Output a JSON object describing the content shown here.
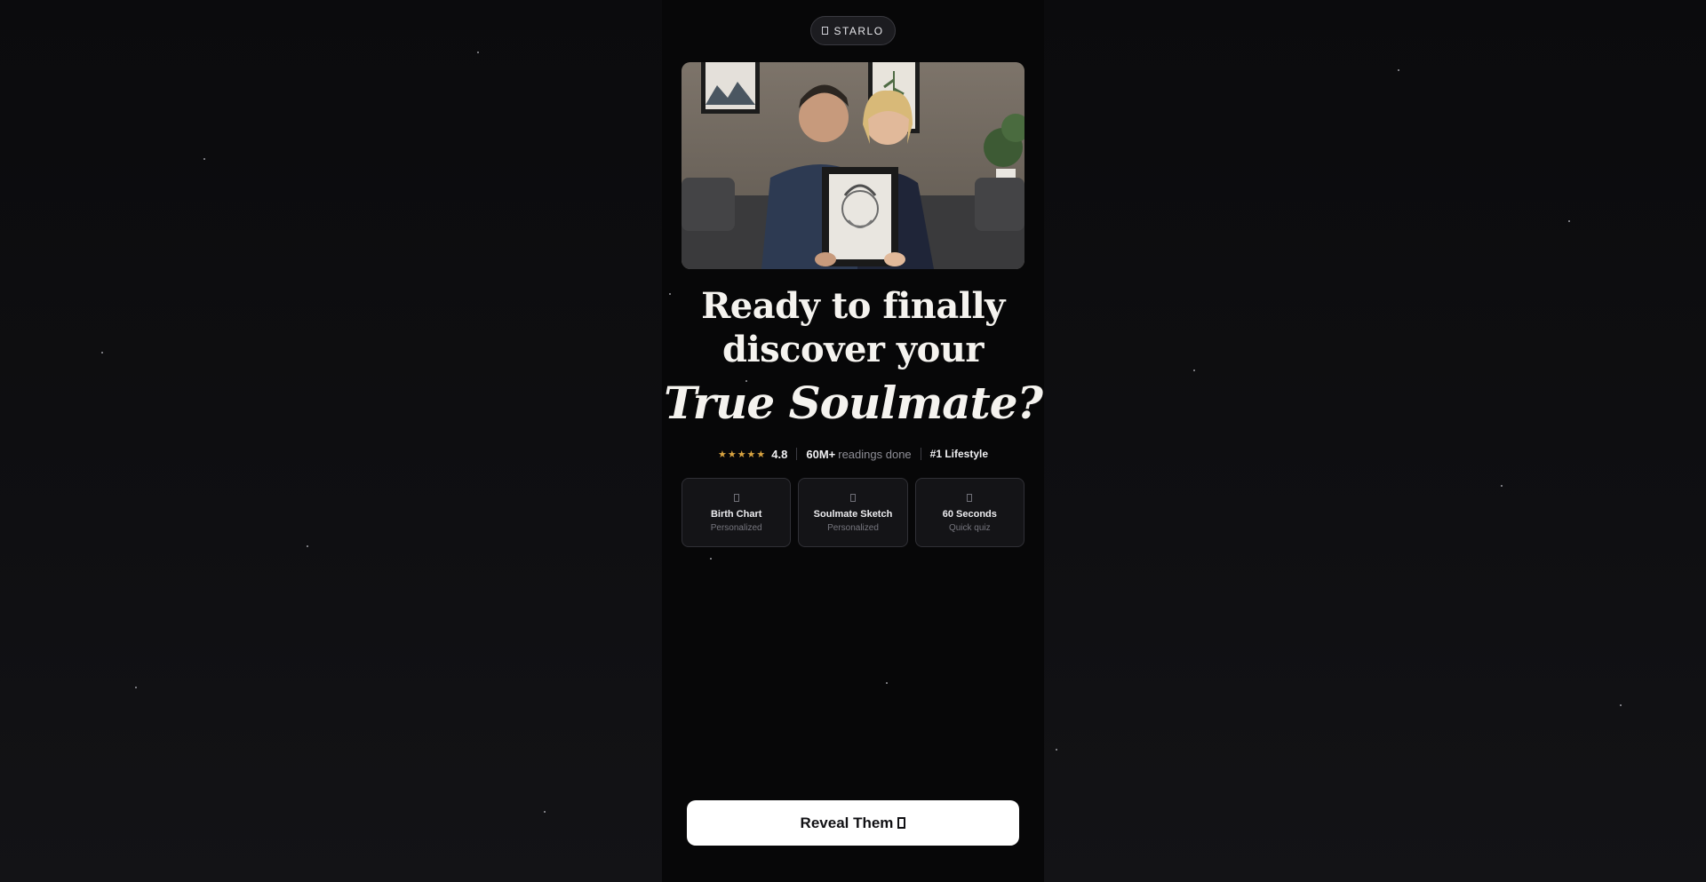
{
  "brand": {
    "name": "STARLO",
    "icon": "star-icon"
  },
  "hero": {
    "image_description_icon": "couple-photo"
  },
  "headline": {
    "line1": "Ready to finally",
    "line2": "discover your",
    "accent": "True Soulmate?"
  },
  "stats": {
    "stars_glyph": "★★★★★",
    "rating": "4.8",
    "readings_count": "60M+",
    "readings_label": "readings done",
    "rank": "#1 Lifestyle"
  },
  "features": [
    {
      "icon": "chart-icon",
      "title": "Birth Chart",
      "subtitle": "Personalized"
    },
    {
      "icon": "pencil-icon",
      "title": "Soulmate Sketch",
      "subtitle": "Personalized"
    },
    {
      "icon": "clock-icon",
      "title": "60 Seconds",
      "subtitle": "Quick quiz"
    }
  ],
  "cta": {
    "label": "Reveal Them",
    "icon": "arrow-right-icon"
  },
  "colors": {
    "background": "#0a0a0c",
    "column": "#070708",
    "accent_gold": "#d9a441",
    "cta_bg": "#ffffff",
    "cta_text": "#111114"
  }
}
